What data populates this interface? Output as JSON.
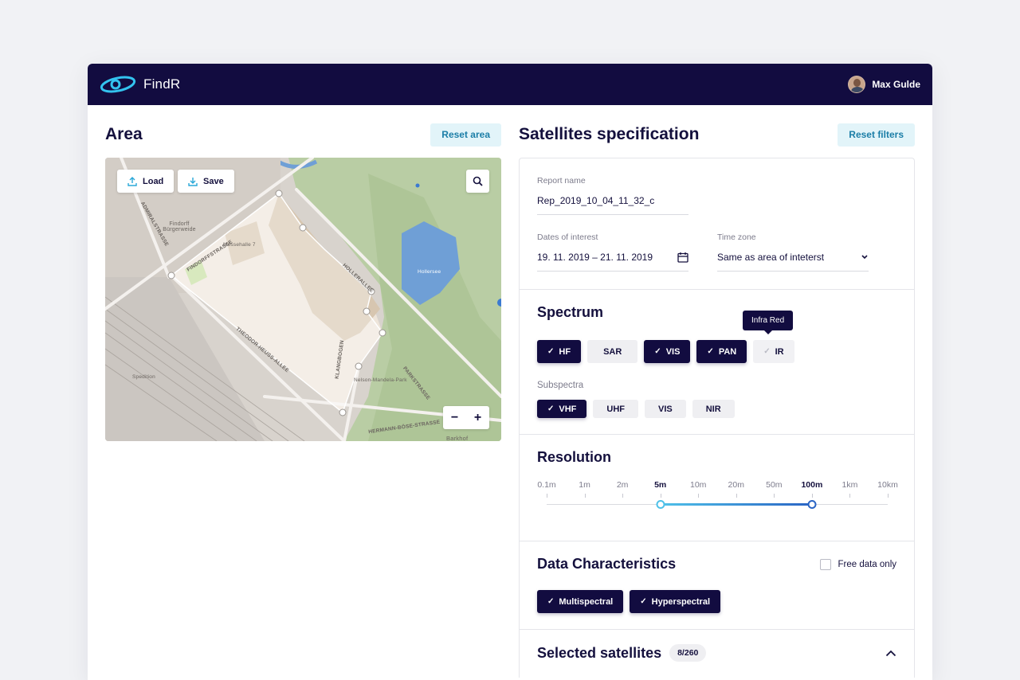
{
  "app": {
    "name": "FindR",
    "user_name": "Max Gulde"
  },
  "area": {
    "title": "Area",
    "reset_label": "Reset area",
    "load_label": "Load",
    "save_label": "Save",
    "zoom_out": "−",
    "zoom_in": "+",
    "street_labels": [
      "FINDORFFSTRASSE",
      "ADMIRALSTRASSE",
      "HOLLERALLEE",
      "THEODOR-HEUSS-ALLEE",
      "PARKSTRASSE",
      "KLANGBOGEN",
      "HERMANN-BÖSE-STRASSE",
      "Findorff Bürgerweide",
      "Messehalle 7",
      "Hollersee",
      "Nelson-Mandela-Park",
      "Barkhof",
      "Spedition"
    ]
  },
  "spec": {
    "title": "Satellites specification",
    "reset_label": "Reset filters",
    "report_name_label": "Report name",
    "report_name_value": "Rep_2019_10_04_11_32_c",
    "dates_label": "Dates of interest",
    "dates_value": "19. 11. 2019 – 21. 11. 2019",
    "timezone_label": "Time zone",
    "timezone_value": "Same as area of inteterst"
  },
  "spectrum": {
    "title": "Spectrum",
    "tooltip": "Infra Red",
    "bands": [
      {
        "label": "HF",
        "selected": true
      },
      {
        "label": "SAR",
        "selected": false
      },
      {
        "label": "VIS",
        "selected": true
      },
      {
        "label": "PAN",
        "selected": true
      },
      {
        "label": "IR",
        "selected": false
      }
    ],
    "subspectra_label": "Subspectra",
    "subspectra": [
      {
        "label": "VHF",
        "selected": true
      },
      {
        "label": "UHF",
        "selected": false
      },
      {
        "label": "VIS",
        "selected": false
      },
      {
        "label": "NIR",
        "selected": false
      }
    ]
  },
  "resolution": {
    "title": "Resolution",
    "ticks": [
      "0.1m",
      "1m",
      "2m",
      "5m",
      "10m",
      "20m",
      "50m",
      "100m",
      "1km",
      "10km"
    ],
    "range_min": "5m",
    "range_max": "100m"
  },
  "data_characteristics": {
    "title": "Data Characteristics",
    "free_only_label": "Free data only",
    "free_only_checked": false,
    "options": [
      {
        "label": "Multispectral",
        "selected": true
      },
      {
        "label": "Hyperspectral",
        "selected": true
      }
    ]
  },
  "selected_satellites": {
    "title": "Selected satellites",
    "count": "8/260"
  },
  "colors": {
    "navy": "#120c40",
    "accent": "#1b7ea7",
    "accent_light": "#4fc1e9",
    "chip_off": "#efeff2"
  }
}
